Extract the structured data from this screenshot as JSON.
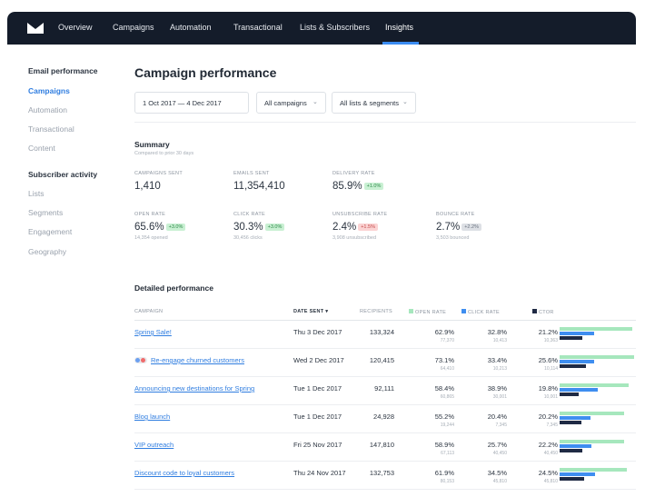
{
  "nav": {
    "items": [
      {
        "label": "Overview",
        "active": false
      },
      {
        "label": "Campaigns",
        "active": false
      },
      {
        "label": "Automation",
        "active": false
      },
      {
        "label": "Transactional",
        "active": false
      },
      {
        "label": "Lists & Subscribers",
        "active": false
      },
      {
        "label": "Insights",
        "active": true
      }
    ]
  },
  "sidebar": {
    "email_heading": "Email performance",
    "email_items": [
      {
        "label": "Campaigns",
        "active": true
      },
      {
        "label": "Automation",
        "active": false
      },
      {
        "label": "Transactional",
        "active": false
      },
      {
        "label": "Content",
        "active": false
      }
    ],
    "subscriber_heading": "Subscriber activity",
    "subscriber_items": [
      {
        "label": "Lists"
      },
      {
        "label": "Segments"
      },
      {
        "label": "Engagement"
      },
      {
        "label": "Geography"
      }
    ]
  },
  "page": {
    "title": "Campaign performance"
  },
  "filters": {
    "date_range": "1 Oct 2017 — 4 Dec 2017",
    "campaigns": "All campaigns",
    "lists": "All lists & segments"
  },
  "summary": {
    "title": "Summary",
    "subtitle": "Compared to prior 30 days",
    "metrics": [
      {
        "label": "CAMPAIGNS SENT",
        "value": "1,410",
        "badge": "",
        "sub": ""
      },
      {
        "label": "EMAILS SENT",
        "value": "11,354,410",
        "badge": "",
        "sub": ""
      },
      {
        "label": "DELIVERY RATE",
        "value": "85.9%",
        "badge": "+1.0%",
        "trend": "up",
        "sub": ""
      },
      {
        "label": "OPEN RATE",
        "value": "65.6%",
        "badge": "+3.0%",
        "trend": "up",
        "sub": "14,354 opened"
      },
      {
        "label": "CLICK RATE",
        "value": "30.3%",
        "badge": "+3.0%",
        "trend": "up",
        "sub": "30,456 clicks"
      },
      {
        "label": "UNSUBSCRIBE RATE",
        "value": "2.4%",
        "badge": "+1.5%",
        "trend": "down",
        "sub": "3,908 unsubscribed"
      },
      {
        "label": "BOUNCE RATE",
        "value": "2.7%",
        "badge": "+2.2%",
        "trend": "neutral",
        "sub": "3,503 bounced"
      }
    ]
  },
  "detail": {
    "title": "Detailed performance",
    "headers": {
      "campaign": "CAMPAIGN",
      "date_sent": "DATE SENT",
      "sort_indicator": "▾",
      "recipients": "RECIPIENTS",
      "open_rate": "OPEN RATE",
      "click_rate": "CLICK RATE",
      "ctor": "CTOR"
    },
    "colors": {
      "open": "#a6e7bd",
      "click": "#3f8ef0",
      "ctor": "#1f2a44"
    },
    "rows": [
      {
        "name": "Spring Sale!",
        "tagged": false,
        "date": "Thu 3 Dec 2017",
        "recipients": "133,324",
        "open": "62.9%",
        "open_n": "77,370",
        "click": "32.8%",
        "click_n": "10,413",
        "ctor": "21.2%",
        "ctor_n": "10,363",
        "open_v": 0.95,
        "click_v": 0.45,
        "ctor_v": 0.3
      },
      {
        "name": "Re-engage churned customers",
        "tagged": true,
        "date": "Wed 2 Dec 2017",
        "recipients": "120,415",
        "open": "73.1%",
        "open_n": "64,410",
        "click": "33.4%",
        "click_n": "10,213",
        "ctor": "25.6%",
        "ctor_n": "10,114",
        "open_v": 0.98,
        "click_v": 0.45,
        "ctor_v": 0.35
      },
      {
        "name": "Announcing new destinations for Spring",
        "tagged": false,
        "date": "Tue 1 Dec 2017",
        "recipients": "92,111",
        "open": "58.4%",
        "open_n": "60,865",
        "click": "38.9%",
        "click_n": "30,001",
        "ctor": "19.8%",
        "ctor_n": "10,001",
        "open_v": 0.9,
        "click_v": 0.5,
        "ctor_v": 0.25
      },
      {
        "name": "Blog launch",
        "tagged": false,
        "date": "Tue 1 Dec 2017",
        "recipients": "24,928",
        "open": "55.2%",
        "open_n": "19,244",
        "click": "20.4%",
        "click_n": "7,345",
        "ctor": "20.2%",
        "ctor_n": "7,345",
        "open_v": 0.85,
        "click_v": 0.4,
        "ctor_v": 0.28
      },
      {
        "name": "VIP outreach",
        "tagged": false,
        "date": "Fri 25 Nov 2017",
        "recipients": "147,810",
        "open": "58.9%",
        "open_n": "67,113",
        "click": "25.7%",
        "click_n": "40,450",
        "ctor": "22.2%",
        "ctor_n": "40,450",
        "open_v": 0.85,
        "click_v": 0.42,
        "ctor_v": 0.3
      },
      {
        "name": "Discount code to loyal customers",
        "tagged": false,
        "date": "Thu 24 Nov 2017",
        "recipients": "132,753",
        "open": "61.9%",
        "open_n": "80,153",
        "click": "34.5%",
        "click_n": "45,810",
        "ctor": "24.5%",
        "ctor_n": "45,810",
        "open_v": 0.88,
        "click_v": 0.47,
        "ctor_v": 0.32
      }
    ]
  }
}
